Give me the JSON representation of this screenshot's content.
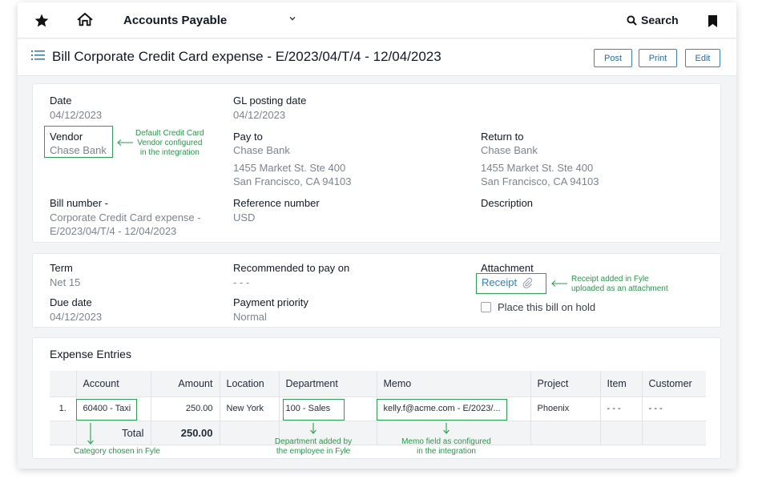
{
  "topbar": {
    "app_title": "Accounts Payable",
    "search_label": "Search"
  },
  "page": {
    "title": "Bill Corporate Credit Card expense - E/2023/04/T/4 - 12/04/2023",
    "buttons": {
      "post": "Post",
      "print": "Print",
      "edit": "Edit"
    }
  },
  "details": {
    "date_label": "Date",
    "date_value": "04/12/2023",
    "gl_label": "GL posting date",
    "gl_value": "04/12/2023",
    "vendor_label": "Vendor",
    "vendor_value": "Chase Bank",
    "payto_label": "Pay to",
    "payto_name": "Chase Bank",
    "payto_addr1": "1455 Market St. Ste 400",
    "payto_addr2": "San Francisco, CA 94103",
    "return_label": "Return to",
    "return_name": "Chase Bank",
    "return_addr1": "1455 Market St. Ste 400",
    "return_addr2": "San Francisco, CA 94103",
    "billno_label": "Bill number -",
    "billno_line1": "Corporate Credit Card expense -",
    "billno_line2": "E/2023/04/T/4 - 12/04/2023",
    "ref_label": "Reference number",
    "ref_value": "USD",
    "desc_label": "Description"
  },
  "terms": {
    "term_label": "Term",
    "term_value": "Net 15",
    "recommended_label": "Recommended to pay on",
    "recommended_value": "- - -",
    "attachment_label": "Attachment",
    "attachment_link": "Receipt",
    "due_label": "Due date",
    "due_value": "04/12/2023",
    "priority_label": "Payment priority",
    "priority_value": "Normal",
    "hold_label": "Place this bill on hold"
  },
  "expenses": {
    "title": "Expense Entries",
    "headers": {
      "account": "Account",
      "amount": "Amount",
      "location": "Location",
      "department": "Department",
      "memo": "Memo",
      "project": "Project",
      "item": "Item",
      "customer": "Customer"
    },
    "row": {
      "index": "1.",
      "account": "60400 - Taxi",
      "amount": "250.00",
      "location": "New York",
      "department": "100 - Sales",
      "memo": "kelly.f@acme.com - E/2023/...",
      "project": "Phoenix",
      "item": "- - -",
      "customer": "- - -"
    },
    "total_label": "Total",
    "total_value": "250.00"
  },
  "annotations": {
    "vendor_line1": "Default Credit Card",
    "vendor_line2": "Vendor configured",
    "vendor_line3": "in the integration",
    "receipt_line1": "Receipt added in Fyle",
    "receipt_line2": "uploaded as an attachment",
    "category": "Category chosen in Fyle",
    "department_line1": "Department added by",
    "department_line2": "the employee in Fyle",
    "memo_line1": "Memo field as configured",
    "memo_line2": "in the integration"
  },
  "colors": {
    "annotation": "#22a64a",
    "accent": "#1f6bb5"
  },
  "icons": [
    "star-icon",
    "home-icon",
    "chevron-down-icon",
    "search-icon",
    "bookmark-icon",
    "list-icon",
    "paperclip-icon"
  ]
}
